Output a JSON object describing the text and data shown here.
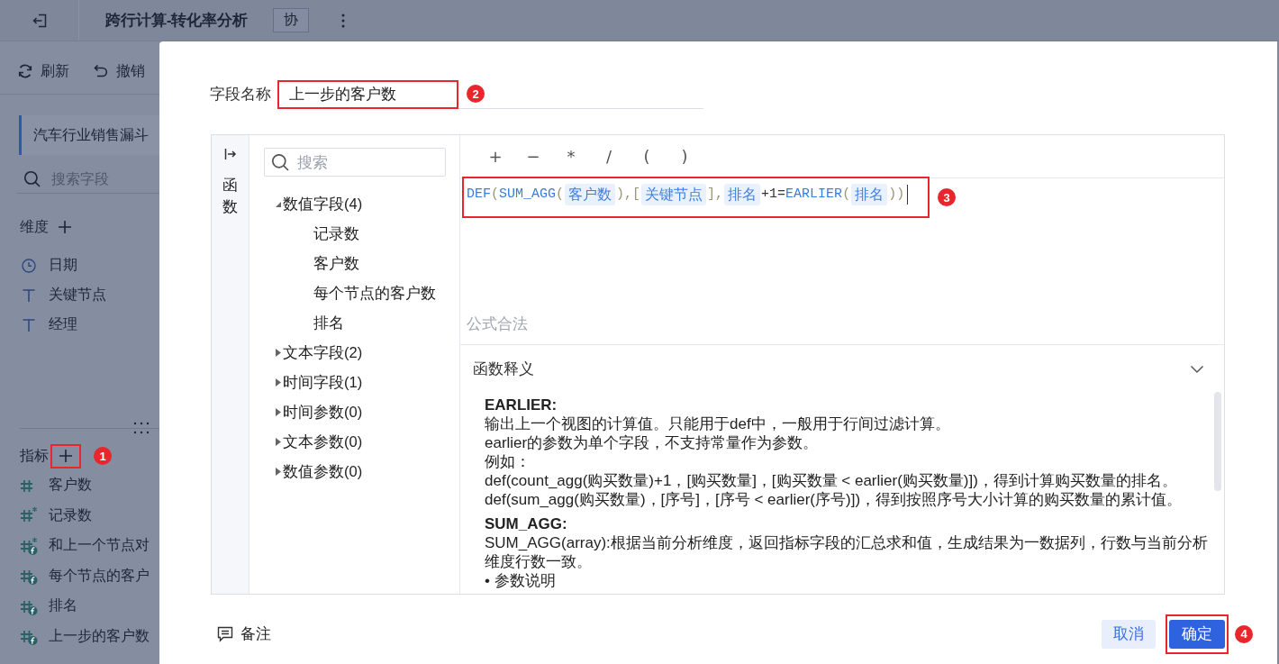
{
  "header": {
    "title": "跨行计算-转化率分析",
    "tag": "协"
  },
  "toolbar": [
    {
      "kind": "refresh",
      "label": "刷新"
    },
    {
      "kind": "undo",
      "label": "撤销"
    }
  ],
  "dataset": {
    "name": "汽车行业销售漏斗",
    "selected": true
  },
  "field_search": {
    "placeholder": "搜索字段"
  },
  "dimensions": {
    "title": "维度",
    "items": [
      {
        "kind": "date",
        "name": "日期"
      },
      {
        "kind": "text",
        "name": "关键节点"
      },
      {
        "kind": "text",
        "name": "经理"
      }
    ]
  },
  "measures": {
    "title": "指标",
    "step_marker": "1",
    "items": [
      {
        "kind": "number",
        "name": "客户数"
      },
      {
        "kind": "count",
        "name": "记录数"
      },
      {
        "kind": "calc_count",
        "name": "和上一个节点对"
      },
      {
        "kind": "calc",
        "name": "每个节点的客户"
      },
      {
        "kind": "calc",
        "name": "排名"
      },
      {
        "kind": "calc",
        "name": "上一步的客户数"
      }
    ]
  },
  "dialog": {
    "field_name": {
      "label": "字段名称",
      "value": "上一步的客户数",
      "step_marker": "2"
    },
    "side_tab": {
      "label": "函数"
    },
    "tree_search": {
      "placeholder": "搜索"
    },
    "field_tree": [
      {
        "name": "数值字段(4)",
        "expanded": true,
        "children": [
          {
            "name": "记录数"
          },
          {
            "name": "客户数"
          },
          {
            "name": "每个节点的客户数"
          },
          {
            "name": "排名"
          }
        ]
      },
      {
        "name": "文本字段(2)",
        "expanded": false
      },
      {
        "name": "时间字段(1)",
        "expanded": false
      },
      {
        "name": "时间参数(0)",
        "expanded": false
      },
      {
        "name": "文本参数(0)",
        "expanded": false
      },
      {
        "name": "数值参数(0)",
        "expanded": false
      }
    ],
    "operators": [
      "+",
      "−",
      "*",
      "/",
      "(",
      ")"
    ],
    "formula": {
      "step_marker": "3",
      "tokens": [
        {
          "kind": "function",
          "text": "DEF"
        },
        {
          "kind": "punct",
          "text": "("
        },
        {
          "kind": "function",
          "text": "SUM_AGG"
        },
        {
          "kind": "punct",
          "text": "("
        },
        {
          "kind": "field",
          "text": "客户数"
        },
        {
          "kind": "punct",
          "text": "),["
        },
        {
          "kind": "field",
          "text": "关键节点"
        },
        {
          "kind": "punct",
          "text": "],"
        },
        {
          "kind": "field",
          "text": "排名"
        },
        {
          "kind": "operator",
          "text": "+1="
        },
        {
          "kind": "function",
          "text": "EARLIER"
        },
        {
          "kind": "punct",
          "text": "("
        },
        {
          "kind": "field",
          "text": "排名"
        },
        {
          "kind": "punct",
          "text": "))"
        }
      ]
    },
    "status": "公式合法",
    "help": {
      "title": "函数释义",
      "expanded": true,
      "entries": [
        {
          "kind": "heading",
          "text": "EARLIER:"
        },
        {
          "kind": "text",
          "text": "输出上一个视图的计算值。只能用于def中，一般用于行间过滤计算。"
        },
        {
          "kind": "text",
          "text": "earlier的参数为单个字段，不支持常量作为参数。"
        },
        {
          "kind": "text",
          "text": "例如："
        },
        {
          "kind": "text",
          "text": "def(count_agg(购买数量)+1，[购买数量]，[购买数量 < earlier(购买数量)])，得到计算购买数量的排名。"
        },
        {
          "kind": "text",
          "text": "def(sum_agg(购买数量)，[序号]，[序号 < earlier(序号)])，得到按照序号大小计算的购买数量的累计值。"
        },
        {
          "kind": "heading",
          "text": "SUM_AGG:"
        },
        {
          "kind": "text",
          "text": "SUM_AGG(array):根据当前分析维度，返回指标字段的汇总求和值，生成结果为一数据列，行数与当前分析维度行数一致。"
        },
        {
          "kind": "text",
          "text": "• 参数说明"
        }
      ]
    },
    "footer": {
      "note": "备注",
      "cancel": "取消",
      "confirm": "确定",
      "step_marker": "4"
    }
  }
}
